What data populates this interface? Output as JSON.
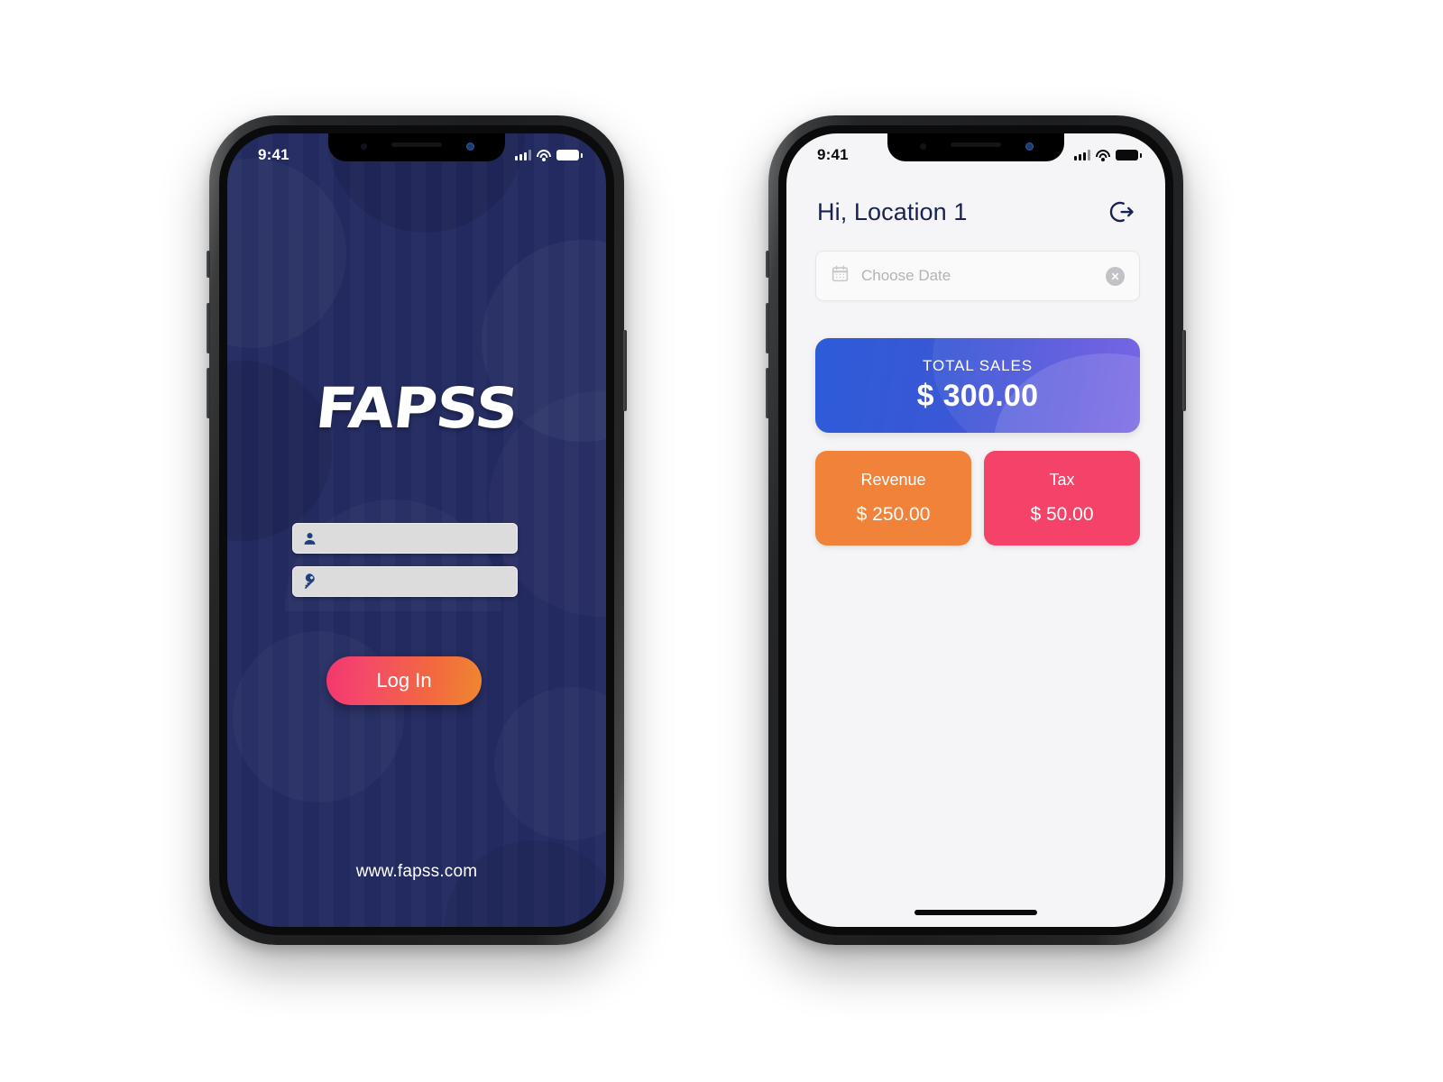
{
  "colors": {
    "navy": "#232a60",
    "accent_pink": "#f4376d",
    "accent_orange": "#f0862f",
    "sales_blue": "#2d5cd8",
    "sales_purple": "#6e5ce2",
    "revenue_orange": "#f08239",
    "tax_pink": "#f44268",
    "text_navy": "#172252"
  },
  "login": {
    "status_bar": {
      "time": "9:41",
      "signal_icon": "signal-bars-icon",
      "wifi_icon": "wifi-icon",
      "battery_icon": "battery-icon"
    },
    "logo_text": "FAPSS",
    "username_field": {
      "value": "",
      "placeholder": "",
      "icon": "person-icon"
    },
    "password_field": {
      "value": "",
      "placeholder": "",
      "icon": "key-icon"
    },
    "login_button_label": "Log In",
    "website_url": "www.fapss.com"
  },
  "dashboard": {
    "status_bar": {
      "time": "9:41",
      "signal_icon": "signal-bars-icon",
      "wifi_icon": "wifi-icon",
      "battery_icon": "battery-icon"
    },
    "greeting": "Hi, Location 1",
    "logout_icon": "logout-icon",
    "date_picker": {
      "value": "",
      "placeholder": "Choose Date",
      "calendar_icon": "calendar-icon",
      "clear_icon": "clear-circle-icon"
    },
    "total_sales": {
      "label": "TOTAL SALES",
      "value": "$ 300.00"
    },
    "metrics": [
      {
        "label": "Revenue",
        "value": "$ 250.00"
      },
      {
        "label": "Tax",
        "value": "$ 50.00"
      }
    ]
  }
}
